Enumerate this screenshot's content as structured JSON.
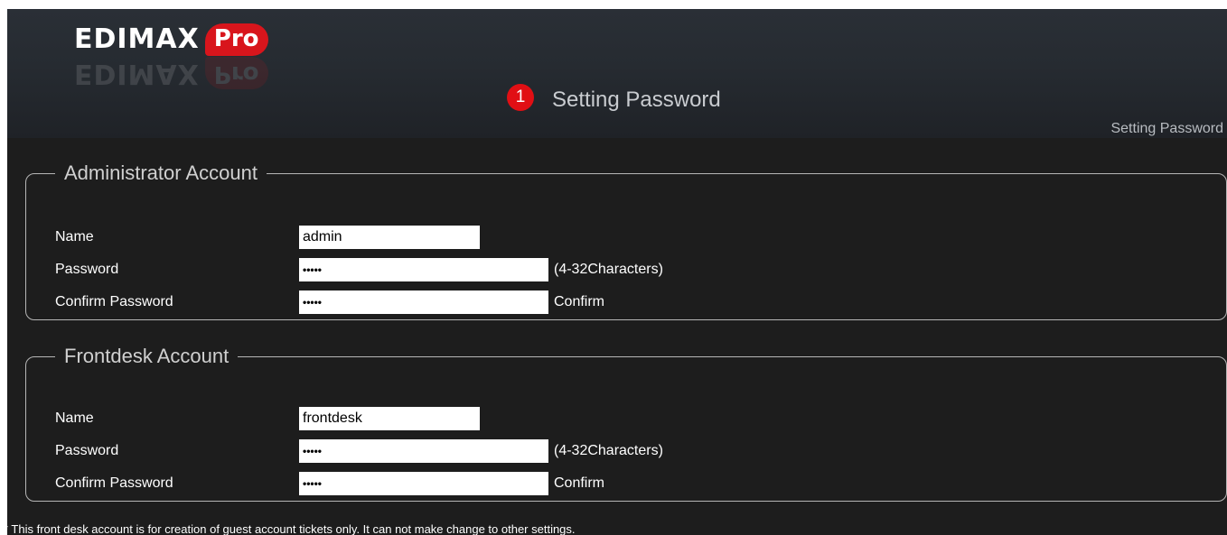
{
  "header": {
    "logo_text": "EDIMAX",
    "logo_pro": "Pro",
    "step_number": "1",
    "step_title": "Setting Password",
    "breadcrumb": "Setting Password"
  },
  "admin": {
    "legend": "Administrator Account",
    "name_label": "Name",
    "name_value": "admin",
    "password_label": "Password",
    "password_value": "•••••",
    "password_hint": "(4-32Characters)",
    "confirm_label": "Confirm Password",
    "confirm_value": "•••••",
    "confirm_hint": "Confirm"
  },
  "frontdesk": {
    "legend": "Frontdesk Account",
    "name_label": "Name",
    "name_value": "frontdesk",
    "password_label": "Password",
    "password_value": "•••••",
    "password_hint": "(4-32Characters)",
    "confirm_label": "Confirm Password",
    "confirm_value": "•••••",
    "confirm_hint": "Confirm"
  },
  "note": "* This front desk account is for creation of guest account tickets only. It can not make change to other settings.",
  "colors": {
    "background": "#1d1d1d",
    "header": "#262b31",
    "brand_red": "#d8151c",
    "badge_red": "#e10f14"
  }
}
